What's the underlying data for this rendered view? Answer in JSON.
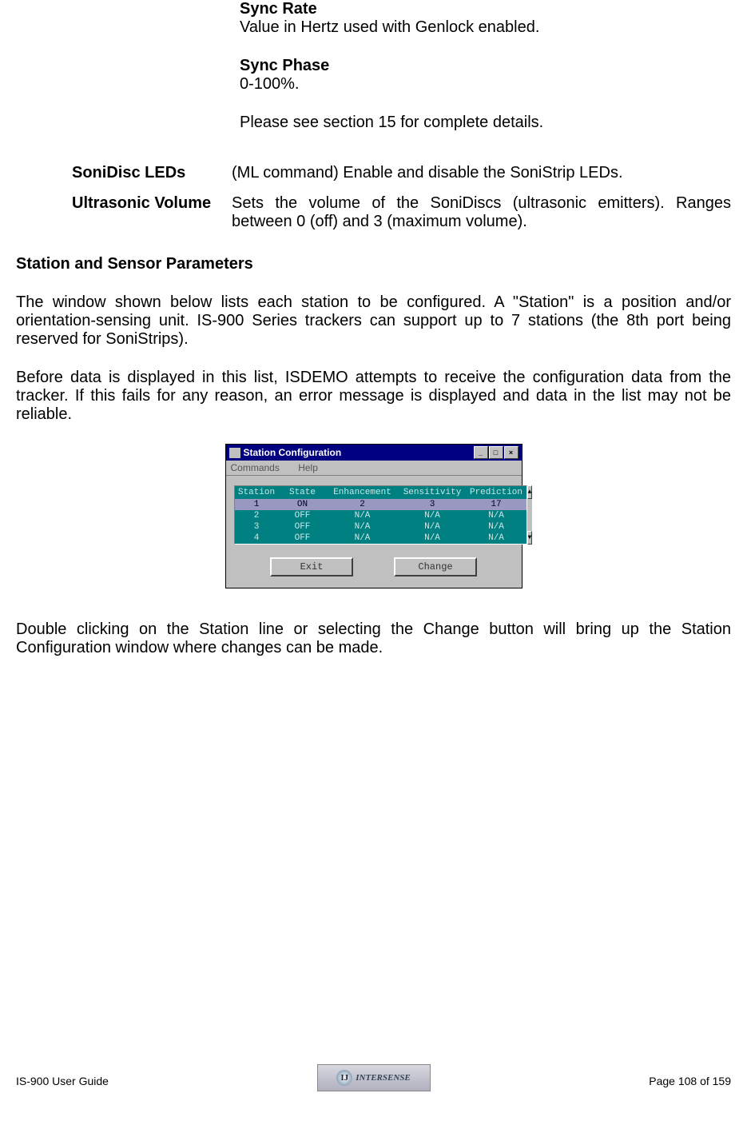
{
  "top_block": {
    "sync_rate_label": "Sync Rate",
    "sync_rate_text": "Value in Hertz used with Genlock enabled.",
    "sync_phase_label": "Sync Phase",
    "sync_phase_text": "0-100%.",
    "see_section": "Please see section 15 for complete details."
  },
  "definitions": [
    {
      "label": "SoniDisc LEDs",
      "text": "(ML command) Enable and disable the SoniStrip LEDs."
    },
    {
      "label": "Ultrasonic Volume",
      "text": "Sets  the  volume  of  the  SoniDiscs  (ultrasonic  emitters).  Ranges between 0 (off) and 3 (maximum volume)."
    }
  ],
  "section_heading": "Station and Sensor Parameters",
  "para1": "The window shown below lists each station to be configured.  A \"Station\" is a position and/or orientation-sensing unit.  IS-900 Series trackers can support up to 7 stations (the 8th port being reserved for SoniStrips).",
  "para2": "Before data is displayed in this list, ISDEMO attempts to receive the configuration data from the tracker.  If this fails for any reason, an error message is displayed and data in the list may not be reliable.",
  "window": {
    "title": "Station Configuration",
    "menu": {
      "commands": "Commands",
      "help": "Help"
    },
    "headers": {
      "station": "Station",
      "state": "State",
      "enhancement": "Enhancement",
      "sensitivity": "Sensitivity",
      "prediction": "Prediction"
    },
    "rows": [
      {
        "station": "1",
        "state": "ON",
        "enhancement": "2",
        "sensitivity": "3",
        "prediction": "17",
        "selected": true
      },
      {
        "station": "2",
        "state": "OFF",
        "enhancement": "N/A",
        "sensitivity": "N/A",
        "prediction": "N/A",
        "selected": false
      },
      {
        "station": "3",
        "state": "OFF",
        "enhancement": "N/A",
        "sensitivity": "N/A",
        "prediction": "N/A",
        "selected": false
      },
      {
        "station": "4",
        "state": "OFF",
        "enhancement": "N/A",
        "sensitivity": "N/A",
        "prediction": "N/A",
        "selected": false
      }
    ],
    "buttons": {
      "exit": "Exit",
      "change": "Change"
    }
  },
  "para3": "Double  clicking  on  the  Station  line  or  selecting  the  Change  button  will  bring  up  the Station Configuration window where changes can be made.",
  "footer": {
    "left": "IS-900 User Guide",
    "right": "Page 108 of 159",
    "logo_text": "INTERSENSE",
    "logo_letter": "IJ"
  }
}
